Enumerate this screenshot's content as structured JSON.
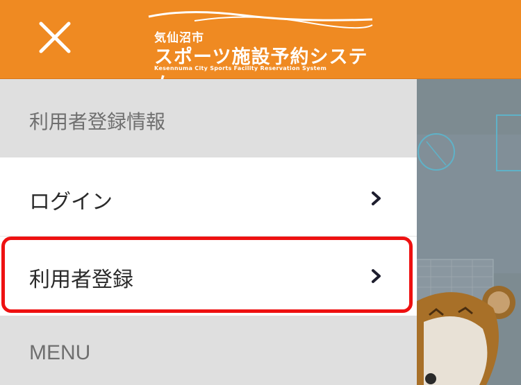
{
  "header": {
    "logo_city": "気仙沼市",
    "logo_title": "スポーツ施設予約システム",
    "logo_subtitle": "Kesennuma City Sports Facility Reservation System",
    "close_icon": "close-icon"
  },
  "menu": {
    "section_user": "利用者登録情報",
    "items": [
      {
        "label": "ログイン",
        "icon": "chevron-right-icon"
      },
      {
        "label": "利用者登録",
        "icon": "chevron-right-icon",
        "highlighted": true
      }
    ],
    "section_menu": "MENU"
  },
  "colors": {
    "header_bg": "#ef8a22",
    "section_bg": "#dfdfdf",
    "highlight": "#ee1111",
    "backdrop": "#7d8b91"
  }
}
